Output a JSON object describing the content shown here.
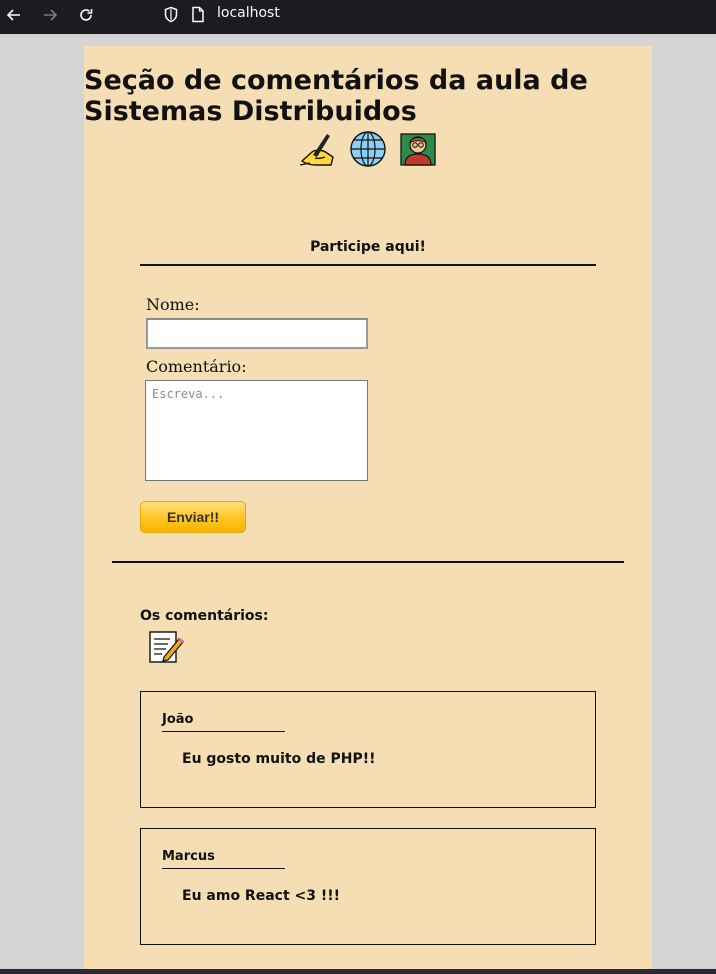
{
  "browser": {
    "url": "localhost",
    "icons": [
      "back-arrow-icon",
      "forward-arrow-icon",
      "reload-icon",
      "shield-icon",
      "page-icon"
    ]
  },
  "page": {
    "title": "Seção de comentários da aula de Sistemas Distribuidos",
    "header_icons": [
      "writing-hand-icon",
      "globe-icon",
      "teacher-icon"
    ],
    "colors": {
      "background": "#f5deb3",
      "button": "#ffc21e"
    }
  },
  "form": {
    "heading": "Participe aqui!",
    "name_label": "Nome:",
    "name_value": "",
    "comment_label": "Comentário:",
    "comment_placeholder": "Escreva...",
    "submit_label": "Enviar!!"
  },
  "comments": {
    "heading": "Os comentários:",
    "icon": "memo-icon",
    "items": [
      {
        "author": "João",
        "text": "Eu gosto muito de PHP!!"
      },
      {
        "author": "Marcus",
        "text": "Eu amo React <3 !!!"
      }
    ]
  }
}
